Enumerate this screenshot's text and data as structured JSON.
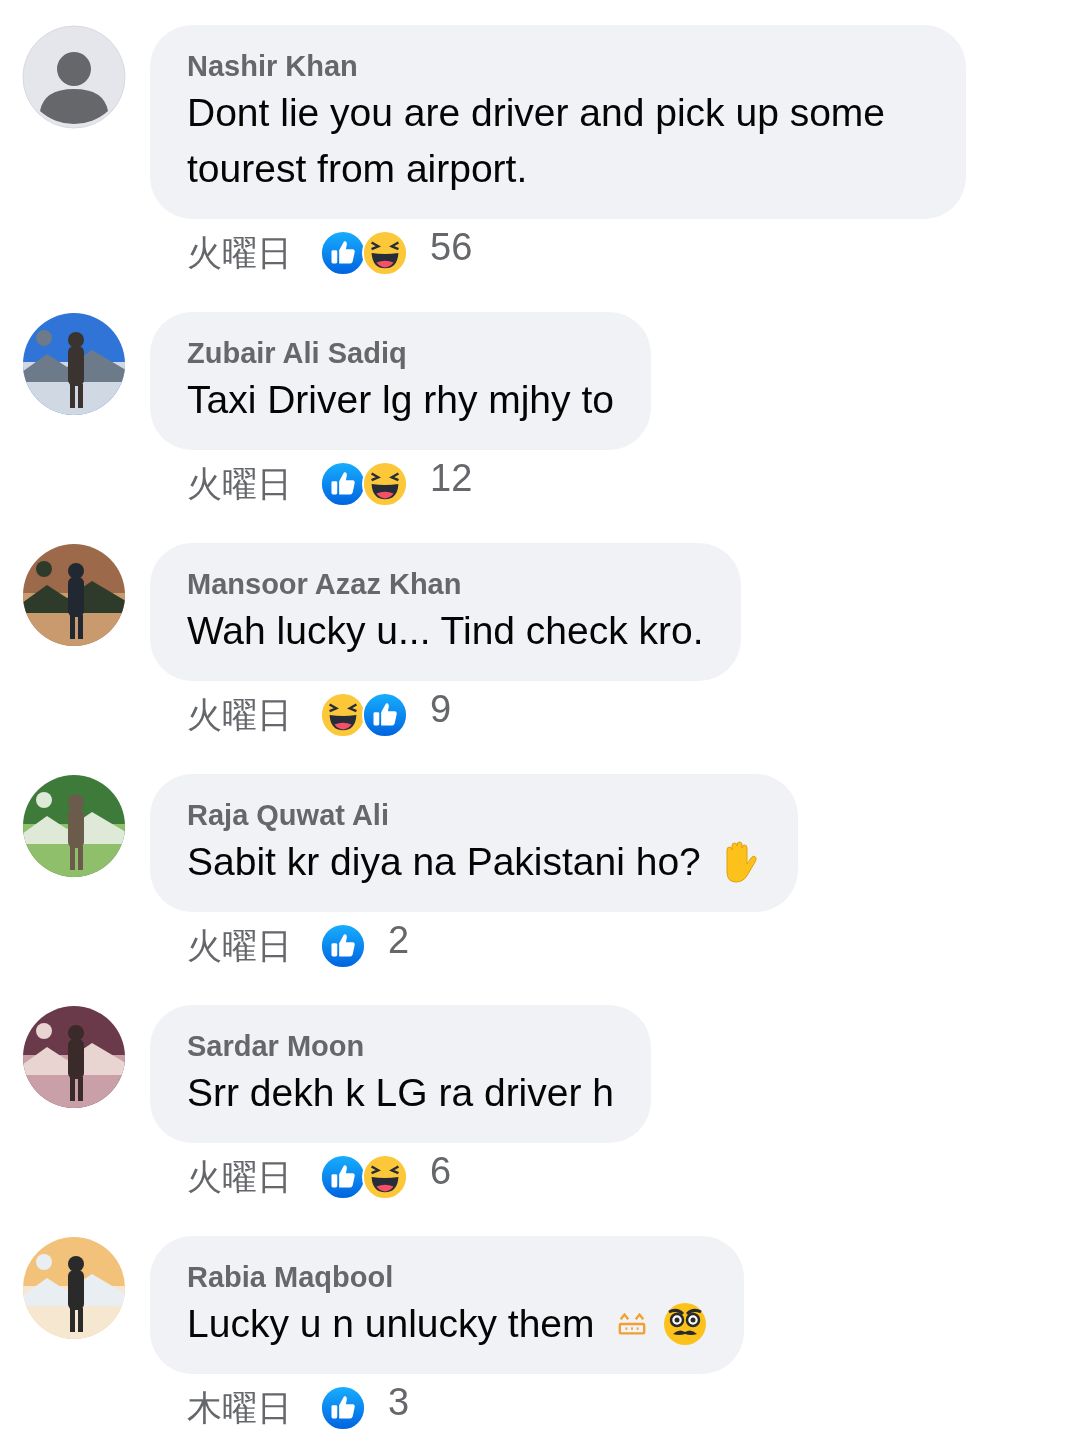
{
  "comments": [
    {
      "avatar": {
        "kind": "default"
      },
      "author": "Nashir Khan",
      "text": "Dont lie you are driver and pick up some tourest from airport.",
      "time": "火曜日",
      "reactions": [
        {
          "kind": "like"
        },
        {
          "kind": "haha"
        }
      ],
      "count": "56"
    },
    {
      "avatar": {
        "kind": "picture"
      },
      "author": "Zubair Ali Sadiq",
      "text": "Taxi Driver lg rhy mjhy to",
      "time": "火曜日",
      "reactions": [
        {
          "kind": "like"
        },
        {
          "kind": "haha"
        }
      ],
      "count": "12"
    },
    {
      "avatar": {
        "kind": "picture"
      },
      "author": "Mansoor Azaz Khan",
      "text": "Wah lucky u... Tind check kro.",
      "time": "火曜日",
      "reactions": [
        {
          "kind": "haha"
        },
        {
          "kind": "like"
        }
      ],
      "count": "9"
    },
    {
      "avatar": {
        "kind": "picture"
      },
      "author": "Raja Quwat Ali",
      "text": "Sabit kr diya na Pakistani ho?",
      "emojis": [
        {
          "kind": "hand"
        }
      ],
      "time": "火曜日",
      "reactions": [
        {
          "kind": "like"
        }
      ],
      "count": "2"
    },
    {
      "avatar": {
        "kind": "picture"
      },
      "author": "Sardar Moon",
      "text": "Srr dekh k LG ra driver h",
      "time": "火曜日",
      "reactions": [
        {
          "kind": "like"
        },
        {
          "kind": "haha"
        }
      ],
      "count": "6"
    },
    {
      "avatar": {
        "kind": "picture"
      },
      "author": "Rabia Maqbool",
      "text": "Lucky u n unlucky them",
      "emojis": [
        {
          "kind": "grin"
        },
        {
          "kind": "disguise"
        }
      ],
      "time": "木曜日",
      "reactions": [
        {
          "kind": "like"
        }
      ],
      "count": "3"
    }
  ]
}
